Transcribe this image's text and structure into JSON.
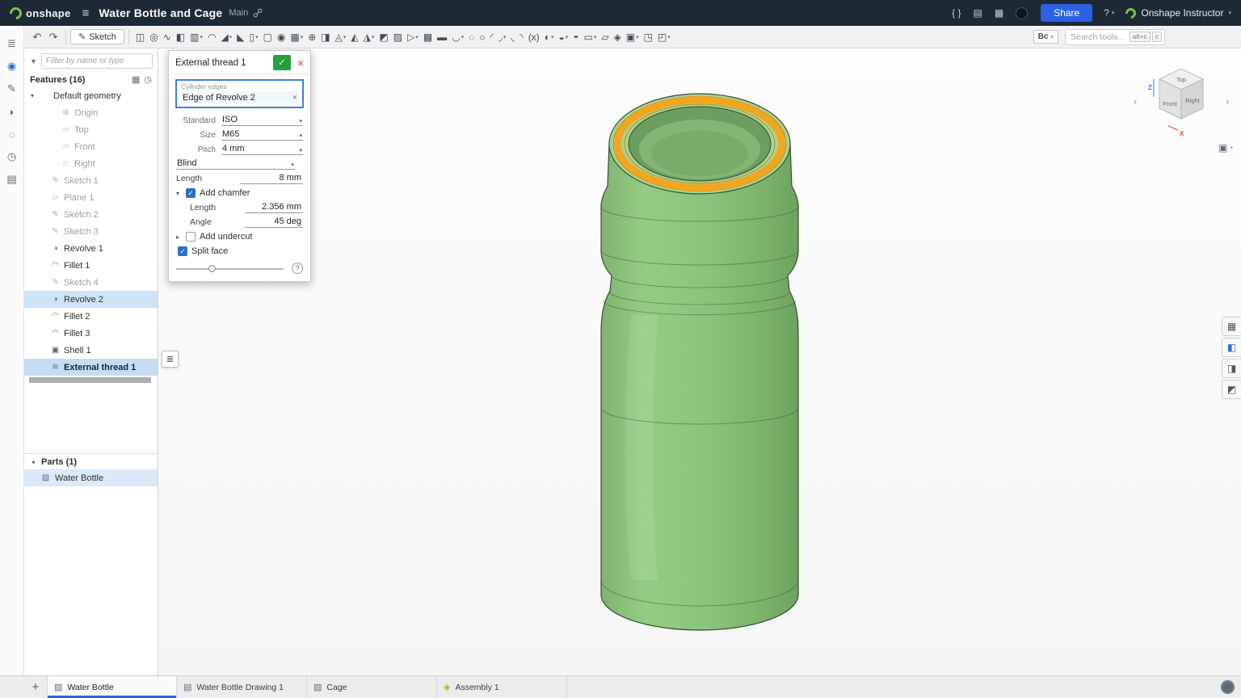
{
  "glyphs": {
    "caret_down": "▾",
    "caret_right": "▸",
    "check": "✓",
    "close": "×",
    "chev_left": "‹",
    "chev_right": "›",
    "hamburger": "≡",
    "undo": "↶",
    "redo": "↷",
    "question": "?",
    "funnel": "▼",
    "folder": "▦",
    "clock": "◷",
    "list": "≣",
    "cube": "▣",
    "sketch": "✎",
    "plane": "▱",
    "origin": "⊕",
    "revolve": "◑",
    "fillet": "◠",
    "shell": "▣",
    "thread": "≋",
    "part": "▧",
    "drawing": "▤",
    "assembly": "◈",
    "add": "+"
  },
  "header": {
    "logo_text": "onshape",
    "title": "Water Bottle and Cage",
    "workspace": "Main",
    "right_icons": [
      {
        "name": "featurescript-icon",
        "glyph": "{ }"
      },
      {
        "name": "document-report-icon",
        "glyph": "▤"
      },
      {
        "name": "app-store-icon",
        "glyph": "▦"
      },
      {
        "name": "learning-badge-icon",
        "glyph": ""
      }
    ],
    "share_label": "Share",
    "user_label": "Onshape Instructor"
  },
  "toolbar": {
    "sketch_label": "Sketch",
    "custom_feature_label": "Bc",
    "search_placeholder": "Search tools...",
    "shortcut_keys": [
      "alt+c",
      "c"
    ],
    "icons": [
      {
        "name": "extrude-icon",
        "glyph": "◫"
      },
      {
        "name": "revolve-icon",
        "glyph": "◎"
      },
      {
        "name": "sweep-icon",
        "glyph": "∿"
      },
      {
        "name": "loft-icon",
        "glyph": "◧"
      },
      {
        "name": "thicken-icon",
        "glyph": "▥",
        "caret": true
      },
      {
        "name": "fillet-icon",
        "glyph": "◠"
      },
      {
        "name": "chamfer-icon",
        "glyph": "◢",
        "caret": true
      },
      {
        "name": "draft-icon",
        "glyph": "◣"
      },
      {
        "name": "rib-icon",
        "glyph": "▯",
        "caret": true
      },
      {
        "name": "shell-icon",
        "glyph": "▢"
      },
      {
        "name": "hole-icon",
        "glyph": "◉"
      },
      {
        "name": "linear-pattern-icon",
        "glyph": "▦",
        "caret": true
      },
      {
        "name": "circular-pattern-icon",
        "glyph": "⊕"
      },
      {
        "name": "mirror-icon",
        "glyph": "◨"
      },
      {
        "name": "boolean-icon",
        "glyph": "◬",
        "caret": true
      },
      {
        "name": "split-icon",
        "glyph": "◭"
      },
      {
        "name": "transform-icon",
        "glyph": "◮",
        "caret": true
      },
      {
        "name": "offset-surface-icon",
        "glyph": "◩"
      },
      {
        "name": "fill-surface-icon",
        "glyph": "▨"
      },
      {
        "name": "move-face-icon",
        "glyph": "▷",
        "caret": true
      },
      {
        "name": "replace-face-icon",
        "glyph": "▩"
      },
      {
        "name": "delete-face-icon",
        "glyph": "▬"
      },
      {
        "name": "modify-fillet-icon",
        "glyph": "◡",
        "caret": true
      },
      {
        "name": "helix-icon",
        "glyph": "◌"
      },
      {
        "name": "point-icon",
        "glyph": "○"
      },
      {
        "name": "curve-icon",
        "glyph": "◜"
      },
      {
        "name": "composite-curve-icon",
        "glyph": "◞",
        "caret": true
      },
      {
        "name": "projected-curve-icon",
        "glyph": "◟"
      },
      {
        "name": "bridging-curve-icon",
        "glyph": "◝"
      },
      {
        "name": "variable-icon",
        "glyph": "(x)"
      },
      {
        "name": "variable-studio-icon",
        "glyph": "◐",
        "caret": true
      },
      {
        "name": "sheet-metal-icon",
        "glyph": "◒",
        "caret": true
      },
      {
        "name": "flange-icon",
        "glyph": "◓"
      },
      {
        "name": "frame-icon",
        "glyph": "▭",
        "caret": true
      },
      {
        "name": "measure-icon",
        "glyph": "▱"
      },
      {
        "name": "assembly-context-icon",
        "glyph": "◈"
      },
      {
        "name": "appearance-icon",
        "glyph": "▣",
        "caret": true
      },
      {
        "name": "configurations-icon",
        "glyph": "◳"
      },
      {
        "name": "named-views-icon",
        "glyph": "◰",
        "caret": true
      }
    ]
  },
  "left_rail": {
    "icons": [
      {
        "name": "feature-list-icon",
        "glyph": "≣"
      },
      {
        "name": "follow-mode-icon",
        "glyph": "◉",
        "active": true
      },
      {
        "name": "edit-appearance-icon",
        "glyph": "✎"
      },
      {
        "name": "comments-icon",
        "glyph": "◗"
      },
      {
        "name": "integrations-icon",
        "glyph": "◌"
      },
      {
        "name": "history-icon",
        "glyph": "◷"
      },
      {
        "name": "notes-icon",
        "glyph": "▤"
      }
    ]
  },
  "feature_panel": {
    "filter_placeholder": "Filter by name or type",
    "features_header": "Features (16)",
    "parts_header": "Parts (1)",
    "features": [
      {
        "label": "Default geometry",
        "level": 0,
        "icon": "",
        "expander": true
      },
      {
        "label": "Origin",
        "level": 2,
        "icon": "origin",
        "state": "gray"
      },
      {
        "label": "Top",
        "level": 2,
        "icon": "plane",
        "state": "gray"
      },
      {
        "label": "Front",
        "level": 2,
        "icon": "plane",
        "state": "gray"
      },
      {
        "label": "Right",
        "level": 2,
        "icon": "plane",
        "state": "gray"
      },
      {
        "label": "Sketch 1",
        "level": 1,
        "icon": "sketch",
        "state": "gray"
      },
      {
        "label": "Plane 1",
        "level": 1,
        "icon": "plane",
        "state": "gray"
      },
      {
        "label": "Sketch 2",
        "level": 1,
        "icon": "sketch",
        "state": "gray"
      },
      {
        "label": "Sketch 3",
        "level": 1,
        "icon": "sketch",
        "state": "gray"
      },
      {
        "label": "Revolve 1",
        "level": 1,
        "icon": "revolve"
      },
      {
        "label": "Fillet 1",
        "level": 1,
        "icon": "fillet"
      },
      {
        "label": "Sketch 4",
        "level": 1,
        "icon": "sketch",
        "state": "gray"
      },
      {
        "label": "Revolve 2",
        "level": 1,
        "icon": "revolve",
        "state": "selected"
      },
      {
        "label": "Fillet 2",
        "level": 1,
        "icon": "fillet"
      },
      {
        "label": "Fillet 3",
        "level": 1,
        "icon": "fillet"
      },
      {
        "label": "Shell 1",
        "level": 1,
        "icon": "shell"
      },
      {
        "label": "External thread 1",
        "level": 1,
        "icon": "thread",
        "state": "editing"
      }
    ],
    "parts": [
      {
        "label": "Water Bottle",
        "icon": "part",
        "state": "selected"
      }
    ]
  },
  "dialog": {
    "title": "External thread 1",
    "selection_label": "Cylinder edges",
    "selection_value": "Edge of Revolve 2",
    "standard_label": "Standard",
    "standard_value": "ISO",
    "size_label": "Size",
    "size_value": "M65",
    "pitch_label": "Pitch",
    "pitch_value": "4 mm",
    "end_type_value": "Blind",
    "length_label": "Length",
    "length_value": "8 mm",
    "add_chamfer_label": "Add chamfer",
    "chamfer_length_label": "Length",
    "chamfer_length_value": "2.356 mm",
    "chamfer_angle_label": "Angle",
    "chamfer_angle_value": "45 deg",
    "add_undercut_label": "Add undercut",
    "split_face_label": "Split face"
  },
  "viewcube": {
    "top": "Top",
    "front": "Front",
    "right": "Right",
    "z": "Z",
    "x": "X"
  },
  "right_tools": [
    {
      "name": "render-options-icon",
      "glyph": "▦"
    },
    {
      "name": "view-settings-icon",
      "glyph": "◧",
      "active": true
    },
    {
      "name": "section-view-icon",
      "glyph": "◨"
    },
    {
      "name": "measure-panel-icon",
      "glyph": "◩"
    }
  ],
  "viewport_colors": {
    "part_green": "#8ac47a",
    "edge_highlight": "#f2a51e"
  },
  "tabs": {
    "add_label": "+",
    "items": [
      {
        "label": "Water Bottle",
        "icon": "part",
        "active": true
      },
      {
        "label": "Water Bottle Drawing 1",
        "icon": "drawing"
      },
      {
        "label": "Cage",
        "icon": "part"
      },
      {
        "label": "Assembly 1",
        "icon": "assembly"
      }
    ]
  }
}
